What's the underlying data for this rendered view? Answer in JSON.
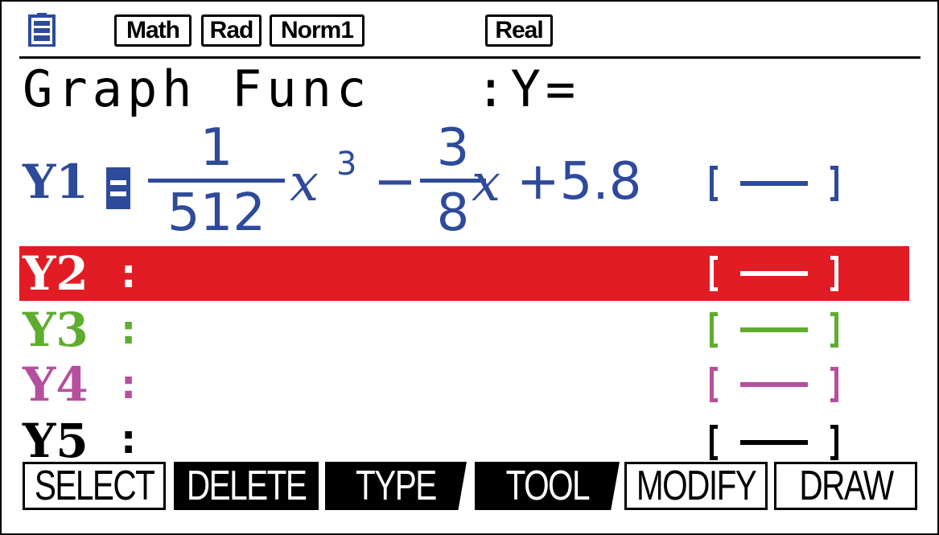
{
  "status_bar": {
    "battery_icon": "battery-icon",
    "indicators": [
      "Math",
      "Rad",
      "Norm1",
      "Real"
    ]
  },
  "header": {
    "title": "Graph Func   :Y="
  },
  "functions": [
    {
      "label": "Y1",
      "expression": {
        "frac1_num": "1",
        "frac1_den": "512",
        "var1": "x",
        "pow1": "3",
        "minus": "−",
        "frac2_num": "3",
        "frac2_den": "8",
        "var2": "x",
        "tail": "+5.8"
      },
      "color": "#2e4a9a",
      "selected": true
    },
    {
      "label": "Y2",
      "colon": ":",
      "color": "#e21c24",
      "highlighted": true
    },
    {
      "label": "Y3",
      "colon": ":",
      "color": "#5fad2e"
    },
    {
      "label": "Y4",
      "colon": ":",
      "color": "#b64f9e"
    },
    {
      "label": "Y5",
      "colon": ":",
      "color": "#000000"
    }
  ],
  "function_keys": [
    {
      "label": "SELECT",
      "style": "outline"
    },
    {
      "label": "DELETE",
      "style": "filled"
    },
    {
      "label": "TYPE",
      "style": "tab"
    },
    {
      "label": "TOOL",
      "style": "tab"
    },
    {
      "label": "MODIFY",
      "style": "outline"
    },
    {
      "label": "DRAW",
      "style": "outline"
    }
  ]
}
